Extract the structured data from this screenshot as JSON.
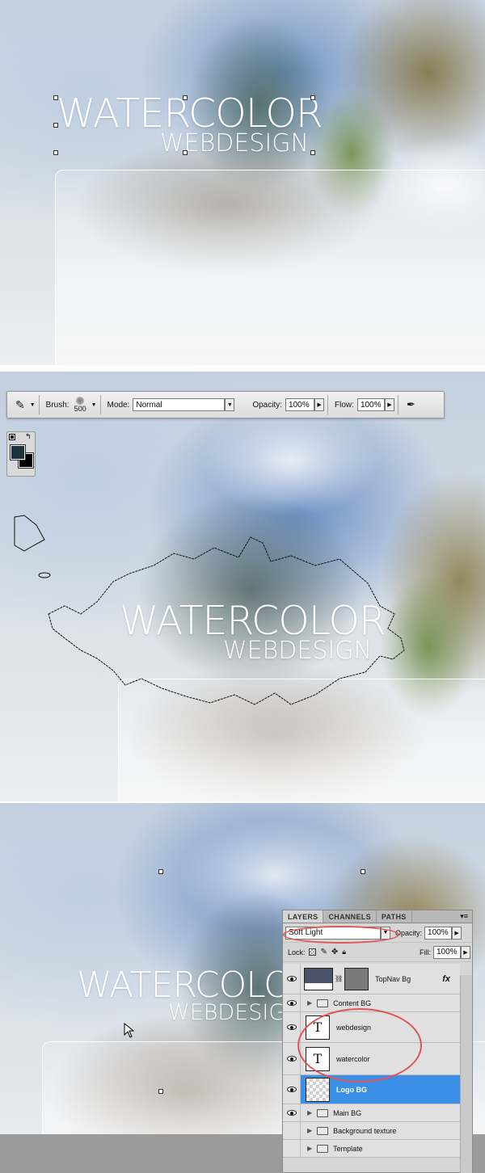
{
  "artwork": {
    "title": "WATERCOLOR",
    "subtitle": "WEBDESIGN"
  },
  "options_bar": {
    "brush_label": "Brush:",
    "brush_size": "500",
    "mode_label": "Mode:",
    "mode_value": "Normal",
    "opacity_label": "Opacity:",
    "opacity_value": "100%",
    "flow_label": "Flow:",
    "flow_value": "100%"
  },
  "colors": {
    "foreground": "#1e3340",
    "background": "#000000"
  },
  "layers_panel": {
    "tabs": [
      "LAYERS",
      "CHANNELS",
      "PATHS"
    ],
    "active_tab": "LAYERS",
    "blend_mode": "Soft Light",
    "opacity_label": "Opacity:",
    "opacity_value": "100%",
    "lock_label": "Lock:",
    "fill_label": "Fill:",
    "fill_value": "100%",
    "layers": [
      {
        "name": "TopNav Bg",
        "type": "image",
        "visible": true,
        "fx": "fx"
      },
      {
        "name": "Content BG",
        "type": "group",
        "visible": true
      },
      {
        "name": "webdesign",
        "type": "text",
        "visible": true,
        "glyph": "T"
      },
      {
        "name": "watercolor",
        "type": "text",
        "visible": true,
        "glyph": "T"
      },
      {
        "name": "Logo BG",
        "type": "image",
        "visible": true,
        "selected": true
      },
      {
        "name": "Main BG",
        "type": "group",
        "visible": true
      },
      {
        "name": "Background texture",
        "type": "group",
        "visible": false
      },
      {
        "name": "Template",
        "type": "group",
        "visible": false
      }
    ]
  }
}
